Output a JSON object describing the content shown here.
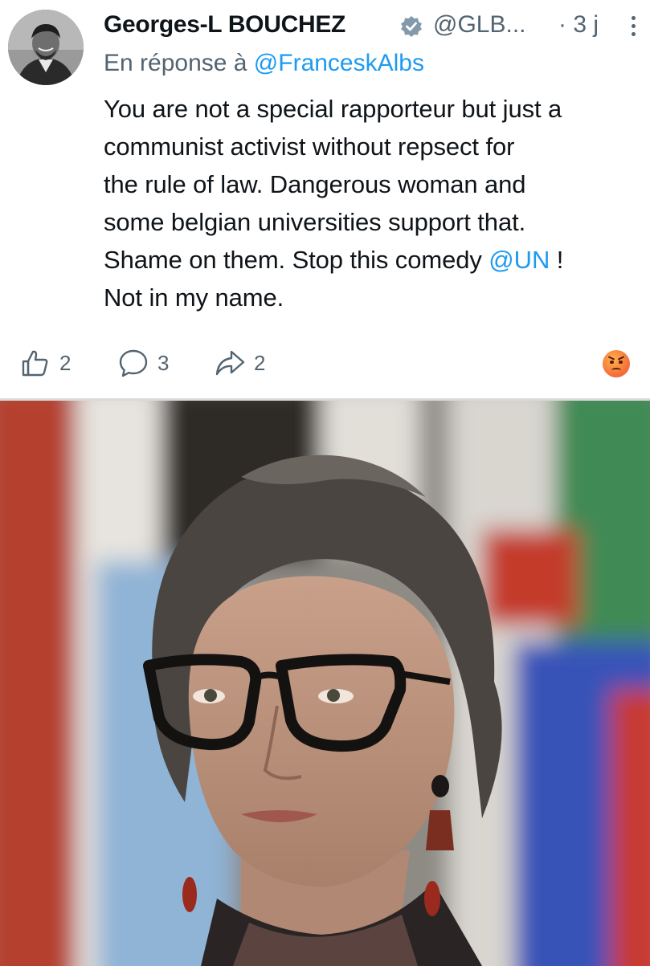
{
  "post": {
    "author_name": "Georges-L BOUCHEZ",
    "handle": "@GLB...",
    "time": "· 3 j",
    "reply_prefix": "En réponse à ",
    "reply_to": "@FranceskAlbs",
    "body": {
      "line1": "You are not a special rapporteur but just a",
      "line2": "communist activist without repsect for",
      "line3": "the rule of law. Dangerous woman and",
      "line4": "some belgian universities support that.",
      "line5_text": "Shame on them. Stop this comedy ",
      "line5_mention": "@UN",
      "line5_end": " !",
      "line6": "Not in my name."
    },
    "actions": {
      "likes": "2",
      "replies": "3",
      "shares": "2"
    }
  },
  "icons": {
    "verified": "verified-badge-icon",
    "more": "more-vertical-icon",
    "like": "thumbs-up-icon",
    "reply": "comment-icon",
    "share": "share-arrow-icon",
    "reaction": "angry-face-icon"
  },
  "colors": {
    "text": "#0f1419",
    "secondary": "#536471",
    "link": "#1d9bf0"
  }
}
